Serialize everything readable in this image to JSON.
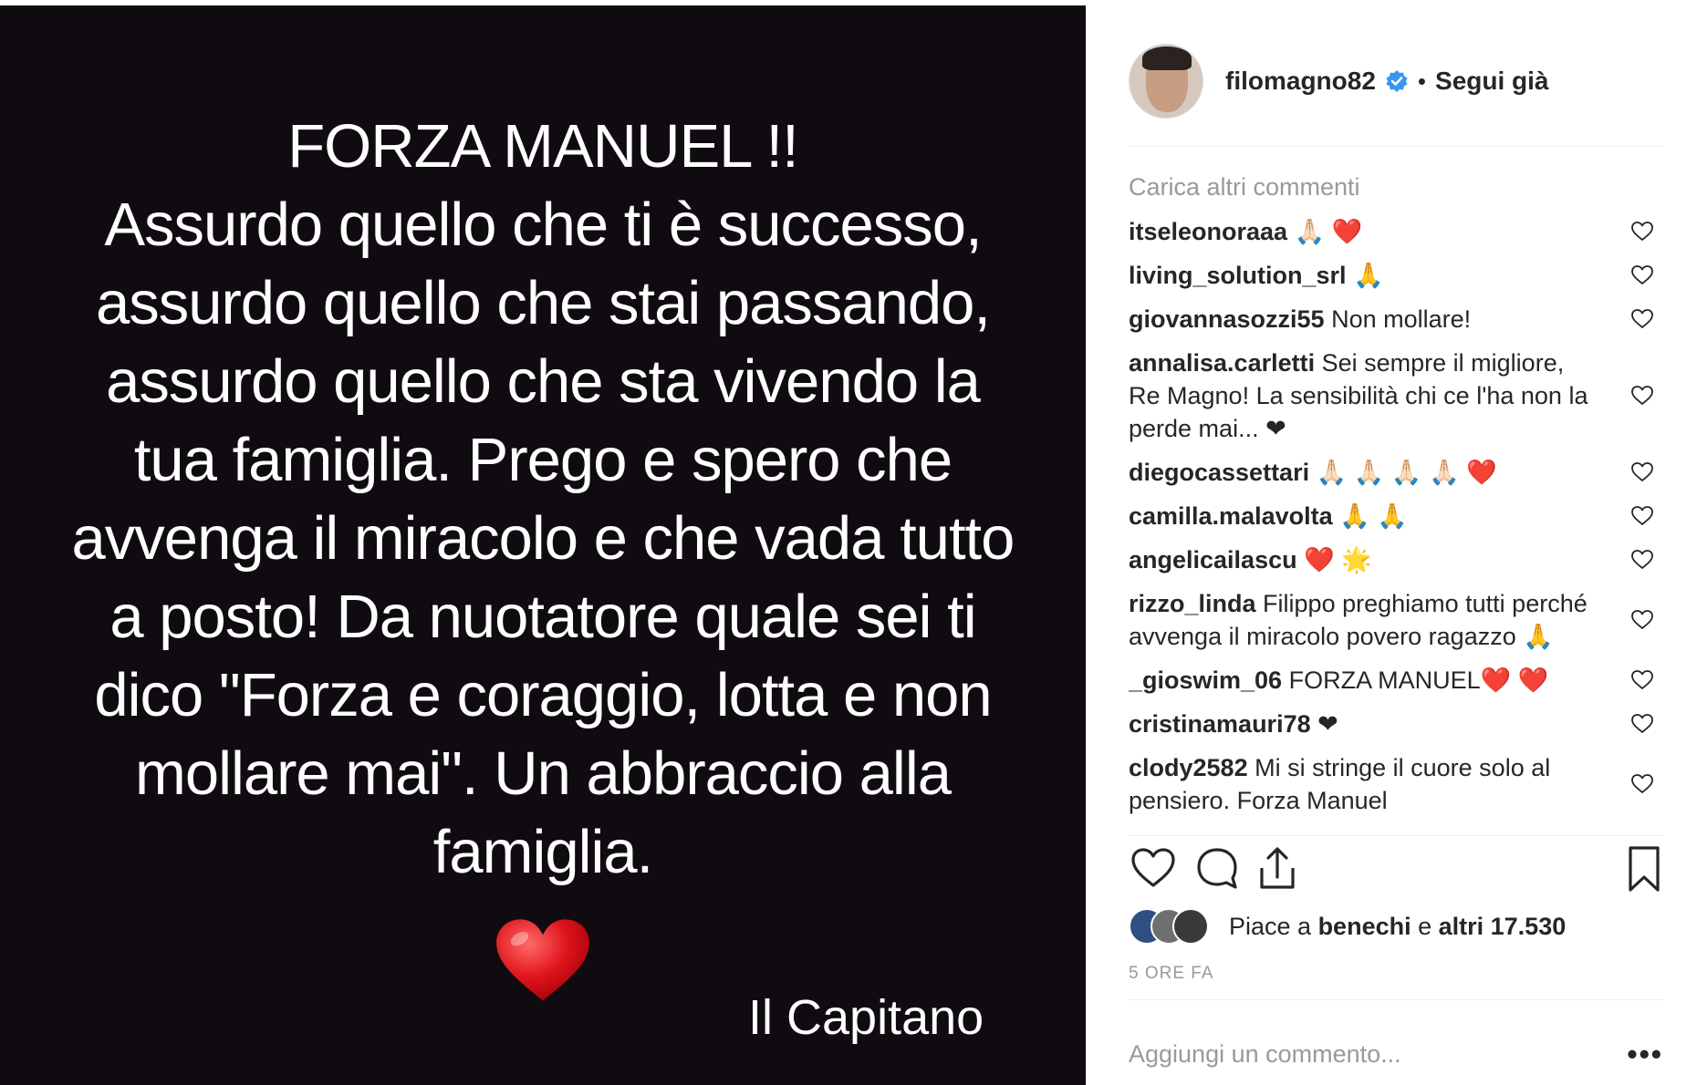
{
  "post": {
    "heading": "FORZA MANUEL !!",
    "body": "Assurdo quello che ti è successo,\nassurdo quello che stai passando,\nassurdo quello che sta vivendo la\ntua famiglia. Prego e spero che\navvenga il miracolo e che vada tutto\na posto! Da nuotatore quale sei ti\ndico \"Forza e coraggio, lotta e non\nmollare mai\". Un abbraccio alla\nfamiglia.",
    "heart_icon": "red-heart-emoji",
    "signature": "Il Capitano",
    "background": "#0f0b10"
  },
  "header": {
    "username": "filomagno82",
    "verified_icon": "verified-badge-icon",
    "separator": "•",
    "follow_status": "Segui già"
  },
  "comments_section": {
    "load_more": "Carica altri commenti",
    "items": [
      {
        "author": "itseleonoraaa",
        "text": "🙏🏻 ❤️"
      },
      {
        "author": "living_solution_srl",
        "text": "🙏"
      },
      {
        "author": "giovannasozzi55",
        "text": "Non mollare!"
      },
      {
        "author": "annalisa.carletti",
        "text": "Sei sempre il migliore, Re Magno! La sensibilità chi ce l'ha non la perde mai... ❤"
      },
      {
        "author": "diegocassettari",
        "text": "🙏🏻 🙏🏻 🙏🏻 🙏🏻 ❤️"
      },
      {
        "author": "camilla.malavolta",
        "text": "🙏 🙏"
      },
      {
        "author": "angelicailascu",
        "text": "❤️ 🌟"
      },
      {
        "author": "rizzo_linda",
        "text": "Filippo preghiamo tutti perché avvenga il miracolo povero ragazzo 🙏"
      },
      {
        "author": "_gioswim_06",
        "text": "FORZA MANUEL❤️ ❤️"
      },
      {
        "author": "cristinamauri78",
        "text": "❤"
      },
      {
        "author": "clody2582",
        "text": "Mi si stringe il cuore solo al pensiero. Forza Manuel"
      }
    ]
  },
  "actions": {
    "like_icon": "heart-outline-icon",
    "comment_icon": "comment-bubble-icon",
    "share_icon": "share-upload-icon",
    "save_icon": "bookmark-icon"
  },
  "likes": {
    "prefix": "Piace a ",
    "first_liker": "benechi",
    "middle": " e ",
    "others": "altri 17.530"
  },
  "timestamp": "5 ORE FA",
  "add_comment": {
    "placeholder": "Aggiungi un commento...",
    "options": "•••"
  },
  "colors": {
    "verified": "#3897f0",
    "muted": "#999999",
    "text": "#262626"
  }
}
